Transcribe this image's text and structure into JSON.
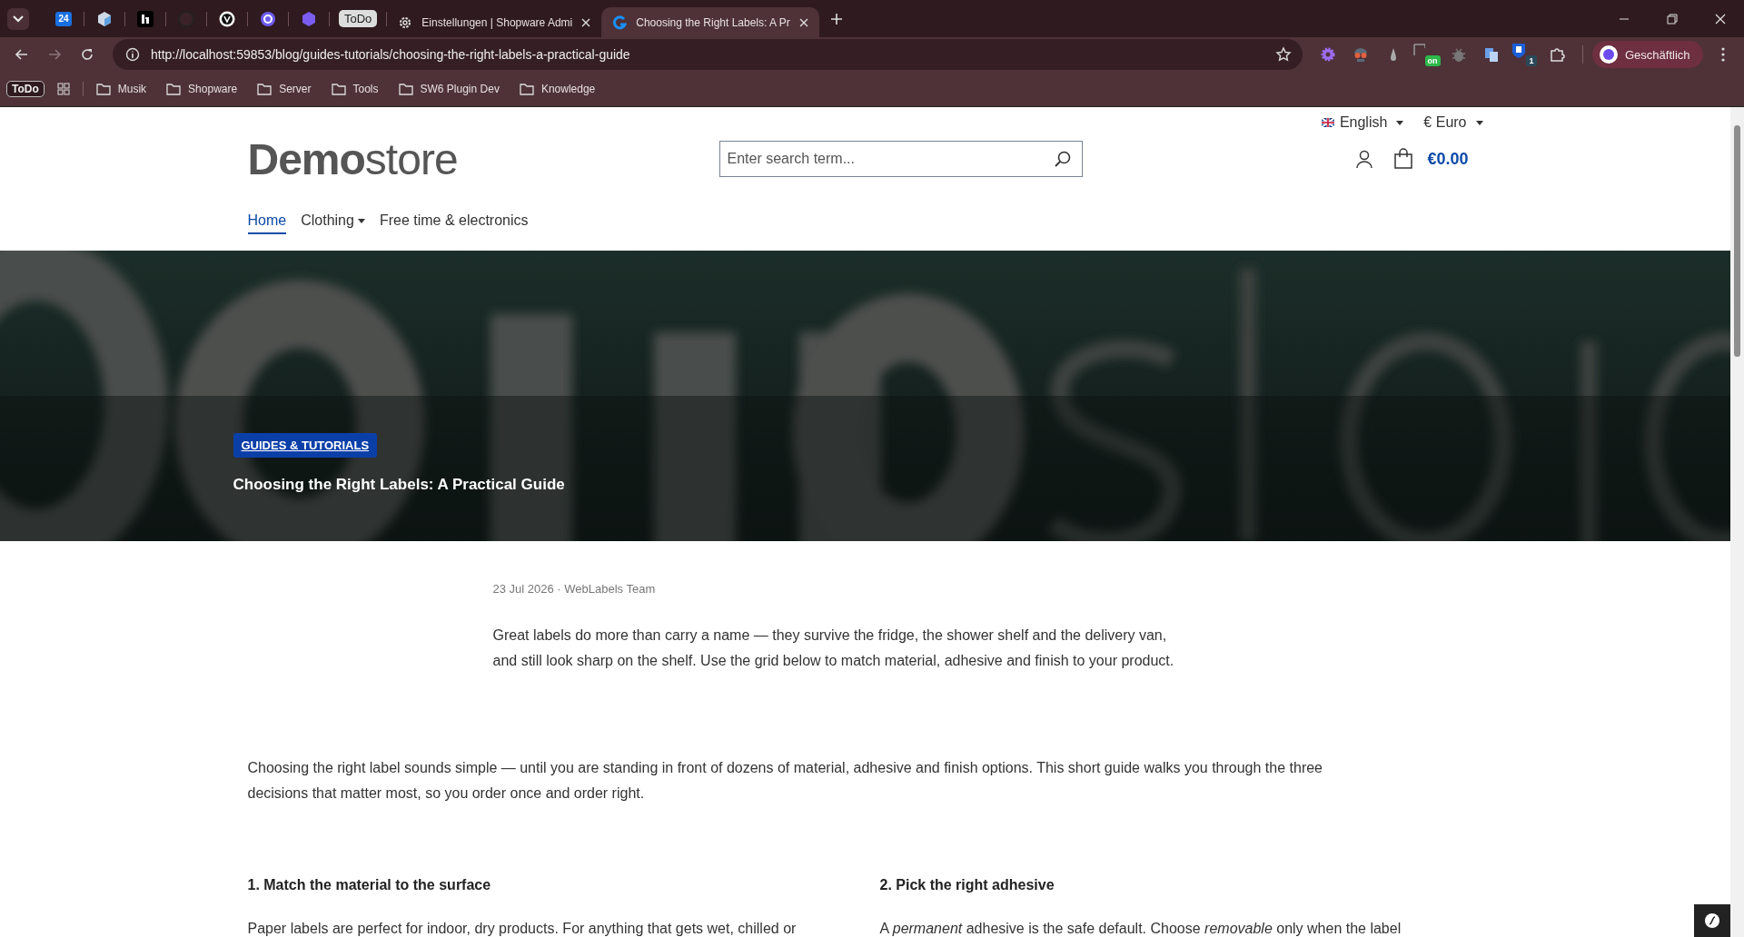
{
  "browser": {
    "tabs": [
      {
        "kind": "pinned",
        "selected": false,
        "text": "24"
      },
      {
        "kind": "pinned",
        "selected": false
      },
      {
        "kind": "pinned",
        "selected": false
      },
      {
        "kind": "pinned",
        "selected": false
      },
      {
        "kind": "pinned",
        "selected": false
      },
      {
        "kind": "pinned",
        "selected": false
      },
      {
        "kind": "pinned",
        "selected": false
      },
      {
        "kind": "label",
        "selected": false,
        "text": "ToDo"
      },
      {
        "kind": "page",
        "selected": false,
        "text": "Einstellungen | Shopware Admi"
      },
      {
        "kind": "page",
        "selected": true,
        "text": "Choosing the Right Labels: A Pr"
      }
    ],
    "url": "http://localhost:59853/blog/guides-tutorials/choosing-the-right-labels-a-practical-guide",
    "extensions": [
      {
        "badge": "on"
      },
      {
        "badge": "1"
      }
    ],
    "profile": "Geschäftlich",
    "bookmarks": [
      {
        "kind": "badge",
        "label": "ToDo"
      },
      {
        "kind": "apps"
      },
      {
        "kind": "folder",
        "label": "Musik"
      },
      {
        "kind": "folder",
        "label": "Shopware"
      },
      {
        "kind": "folder",
        "label": "Server"
      },
      {
        "kind": "folder",
        "label": "Tools"
      },
      {
        "kind": "folder",
        "label": "SW6 Plugin Dev"
      },
      {
        "kind": "folder",
        "label": "Knowledge"
      }
    ]
  },
  "page": {
    "language": "English",
    "currency": "€ Euro",
    "logo": "**Demo**store",
    "search": {
      "placeholder": "Enter search term..."
    },
    "cart": "€0.00",
    "nav": [
      {
        "label": "Home",
        "selected": true,
        "dropdown": false
      },
      {
        "label": "Clothing",
        "selected": false,
        "dropdown": true
      },
      {
        "label": "Free time & electronics",
        "selected": false,
        "dropdown": false
      }
    ],
    "hero": {
      "kind": "picture",
      "badge": "GUIDES & TUTORIALS",
      "title": "Choosing the Right Labels: A Practical Guide"
    },
    "meta": "23 Jul 2026 · WebLabels Team",
    "intro": [
      "Great labels do more than carry a name — they survive the fridge, the shower shelf and the delivery van,",
      "and still look sharp on the shelf. Use the grid below to match material, adhesive and finish to your product."
    ],
    "body": [
      "Choosing the right label sounds simple — until you are standing in front of dozens of material, adhesive and finish options. This short guide walks you through the three",
      "decisions that matter most, so you order once and order right."
    ],
    "sections": [
      {
        "heading": "1. Match the material to the surface",
        "text": "Paper labels are perfect for indoor, dry products. For anything that gets wet, chilled or"
      },
      {
        "heading": "2. Pick the right adhesive",
        "text": "A *permanent* adhesive is the safe default. Choose *removable* only when the label"
      }
    ]
  }
}
